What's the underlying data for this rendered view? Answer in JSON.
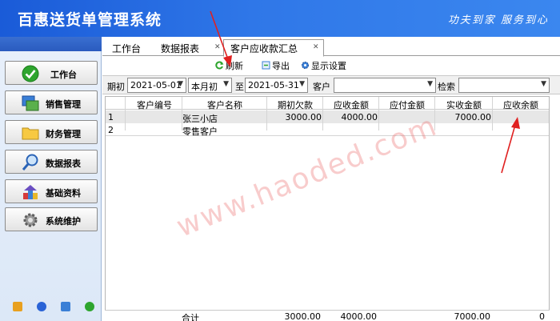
{
  "header": {
    "app_title": "百惠送货单管理系统",
    "slogan": "功夫到家 服务到心"
  },
  "sidebar": {
    "items": [
      {
        "label": "工作台",
        "icon": "check-circle-icon"
      },
      {
        "label": "销售管理",
        "icon": "windows-icon"
      },
      {
        "label": "财务管理",
        "icon": "folder-icon"
      },
      {
        "label": "数据报表",
        "icon": "magnifier-icon"
      },
      {
        "label": "基础资料",
        "icon": "building-blocks-icon"
      },
      {
        "label": "系统维护",
        "icon": "gear-icon"
      }
    ],
    "bottom_icons": [
      "key-icon",
      "clock-icon",
      "search-small-icon",
      "refresh-small-icon"
    ]
  },
  "tabs": [
    {
      "label": "工作台",
      "closable": false
    },
    {
      "label": "数据报表",
      "closable": true
    },
    {
      "label": "客户应收款汇总",
      "closable": true,
      "active": true
    }
  ],
  "toolbar": {
    "refresh_label": "刷新",
    "export_label": "导出",
    "display_settings_label": "显示设置"
  },
  "filter": {
    "period_label": "期初",
    "start_date": "2021-05-01",
    "period_option": "本月初",
    "to_label": "至",
    "end_date": "2021-05-31",
    "customer_label": "客户",
    "customer_value": "",
    "search_label": "检索",
    "search_value": ""
  },
  "table": {
    "columns": [
      "客户编号",
      "客户名称",
      "期初欠款",
      "应收金额",
      "应付金额",
      "实收金额",
      "应收余额"
    ],
    "rows": [
      {
        "no": "1",
        "code": "",
        "name": "张三小店",
        "opening": "3000.00",
        "receivable": "4000.00",
        "payable": "",
        "received": "7000.00",
        "balance": ""
      },
      {
        "no": "2",
        "code": "",
        "name": "零售客户",
        "opening": "",
        "receivable": "",
        "payable": "",
        "received": "",
        "balance": ""
      }
    ],
    "totals": {
      "label": "合计",
      "opening": "3000.00",
      "receivable": "4000.00",
      "payable": "",
      "received": "7000.00",
      "balance": "0"
    }
  },
  "watermark": "www.haoded.com",
  "colors": {
    "header_start": "#1a5bd8",
    "header_end": "#3b87ef",
    "arrow_red": "#e02020",
    "row_selected": "#e7e7e7"
  }
}
